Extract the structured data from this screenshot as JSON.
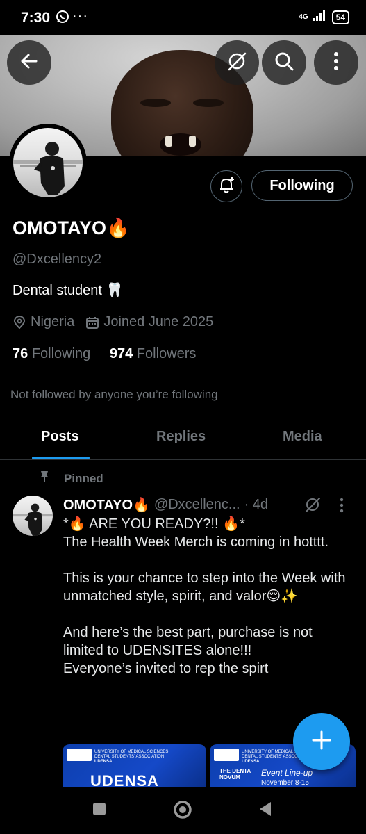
{
  "status_bar": {
    "time": "7:30",
    "network": "4G",
    "battery": "54",
    "dots": "···"
  },
  "header": {
    "back_icon": "arrow-left-icon",
    "grok_icon": "grok-icon",
    "search_icon": "search-icon",
    "more_icon": "more-vertical-icon"
  },
  "profile": {
    "name": "OMOTAYO🔥",
    "handle": "@Dxcellency2",
    "bio": "Dental student 🦷",
    "location": "Nigeria",
    "joined": "Joined June 2025",
    "following_count": "76",
    "following_label": "Following",
    "followers_count": "974",
    "followers_label": "Followers",
    "not_followed": "Not followed by anyone you’re following",
    "follow_button": "Following"
  },
  "tabs": [
    {
      "label": "Posts",
      "active": true
    },
    {
      "label": "Replies",
      "active": false
    },
    {
      "label": "Media",
      "active": false
    }
  ],
  "post": {
    "pinned_label": "Pinned",
    "author": "OMOTAYO🔥",
    "handle": "@Dxcellenc...",
    "time": "· 4d",
    "lines": [
      "*🔥 ARE YOU READY?!! 🔥*",
      "The Health Week Merch is coming in hotttt.",
      "",
      " This is your chance to step into the Week with unmatched style, spirit, and valor😌✨",
      "",
      "And here’s the best part, purchase is not limited to UDENSITES alone!!!",
      "Everyone’s invited to rep the spirt"
    ],
    "media": [
      {
        "caption": "UNIVERSITY OF MEDICAL SCIENCES DENTAL STUDENTS' ASSOCIATION",
        "title": "UDENSA",
        "headline": "UDENSA"
      },
      {
        "caption": "UNIVERSITY OF MEDICAL SCIENCES DENTAL STUDENTS' ASSOCIATION",
        "title": "UDENSA",
        "headline": "THE DENTA NOVUM",
        "subhead": "Event Line-up",
        "dates": "November 8-15"
      }
    ]
  },
  "colors": {
    "accent": "#1d9bf0",
    "background": "#000000",
    "muted_text": "#71767b",
    "border": "#2f3336"
  }
}
